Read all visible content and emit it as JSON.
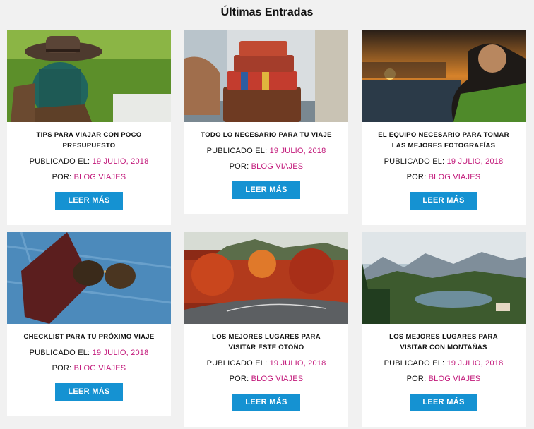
{
  "section_title": "Últimas Entradas",
  "published_label": "PUBLICADO EL:",
  "author_label": "POR:",
  "button_label": "LEER MÁS",
  "posts": [
    {
      "title": "TIPS PARA VIAJAR CON POCO PRESUPUESTO",
      "date": "19 JULIO, 2018",
      "author": "BLOG VIAJES"
    },
    {
      "title": "TODO LO NECESARIO PARA TU VIAJE",
      "date": "19 JULIO, 2018",
      "author": "BLOG VIAJES"
    },
    {
      "title": "EL EQUIPO NECESARIO PARA TOMAR LAS MEJORES FOTOGRAFÍAS",
      "date": "19 JULIO, 2018",
      "author": "BLOG VIAJES"
    },
    {
      "title": "CHECKLIST PARA TU PRÓXIMO VIAJE",
      "date": "19 JULIO, 2018",
      "author": "BLOG VIAJES"
    },
    {
      "title": "LOS MEJORES LUGARES PARA VISITAR ESTE OTOÑO",
      "date": "19 JULIO, 2018",
      "author": "BLOG VIAJES"
    },
    {
      "title": "LOS MEJORES LUGARES PARA VISITAR CON MONTAÑAS",
      "date": "19 JULIO, 2018",
      "author": "BLOG VIAJES"
    }
  ],
  "colors": {
    "accent_button": "#1592d2",
    "link_pink": "#c2187a",
    "background": "#f1f1f1"
  }
}
